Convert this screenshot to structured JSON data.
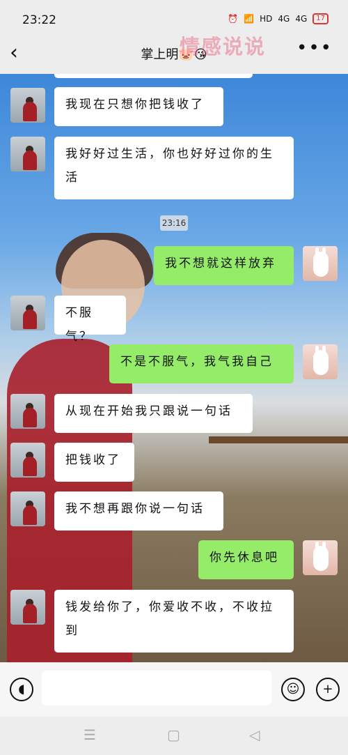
{
  "status": {
    "time": "23:22",
    "hd": "HD",
    "signal1": "4G",
    "signal2": "4G",
    "battery": "17"
  },
  "navbar": {
    "title": "掌上明🐷😘"
  },
  "watermark": "情感说说",
  "timestamp": "23:16",
  "messages": [
    {
      "side": "in",
      "text": "我现在只想你把钱收了"
    },
    {
      "side": "in",
      "text": "我好好过生活，你也好好过你的生活"
    },
    {
      "side": "out",
      "text": "我不想就这样放弃"
    },
    {
      "side": "in",
      "text": "不服气？"
    },
    {
      "side": "out",
      "text": "不是不服气，我气我自己"
    },
    {
      "side": "in",
      "text": "从现在开始我只跟说一句话"
    },
    {
      "side": "in",
      "text": "把钱收了"
    },
    {
      "side": "in",
      "text": "我不想再跟你说一句话"
    },
    {
      "side": "out",
      "text": "你先休息吧"
    },
    {
      "side": "in",
      "text": "钱发给你了，你爱收不收，不收拉到"
    }
  ],
  "input": {
    "value": ""
  },
  "icons": {
    "back": "back-arrow-icon",
    "more": "more-icon",
    "voice": "voice-icon",
    "emoji": "emoji-icon",
    "add": "add-icon"
  }
}
